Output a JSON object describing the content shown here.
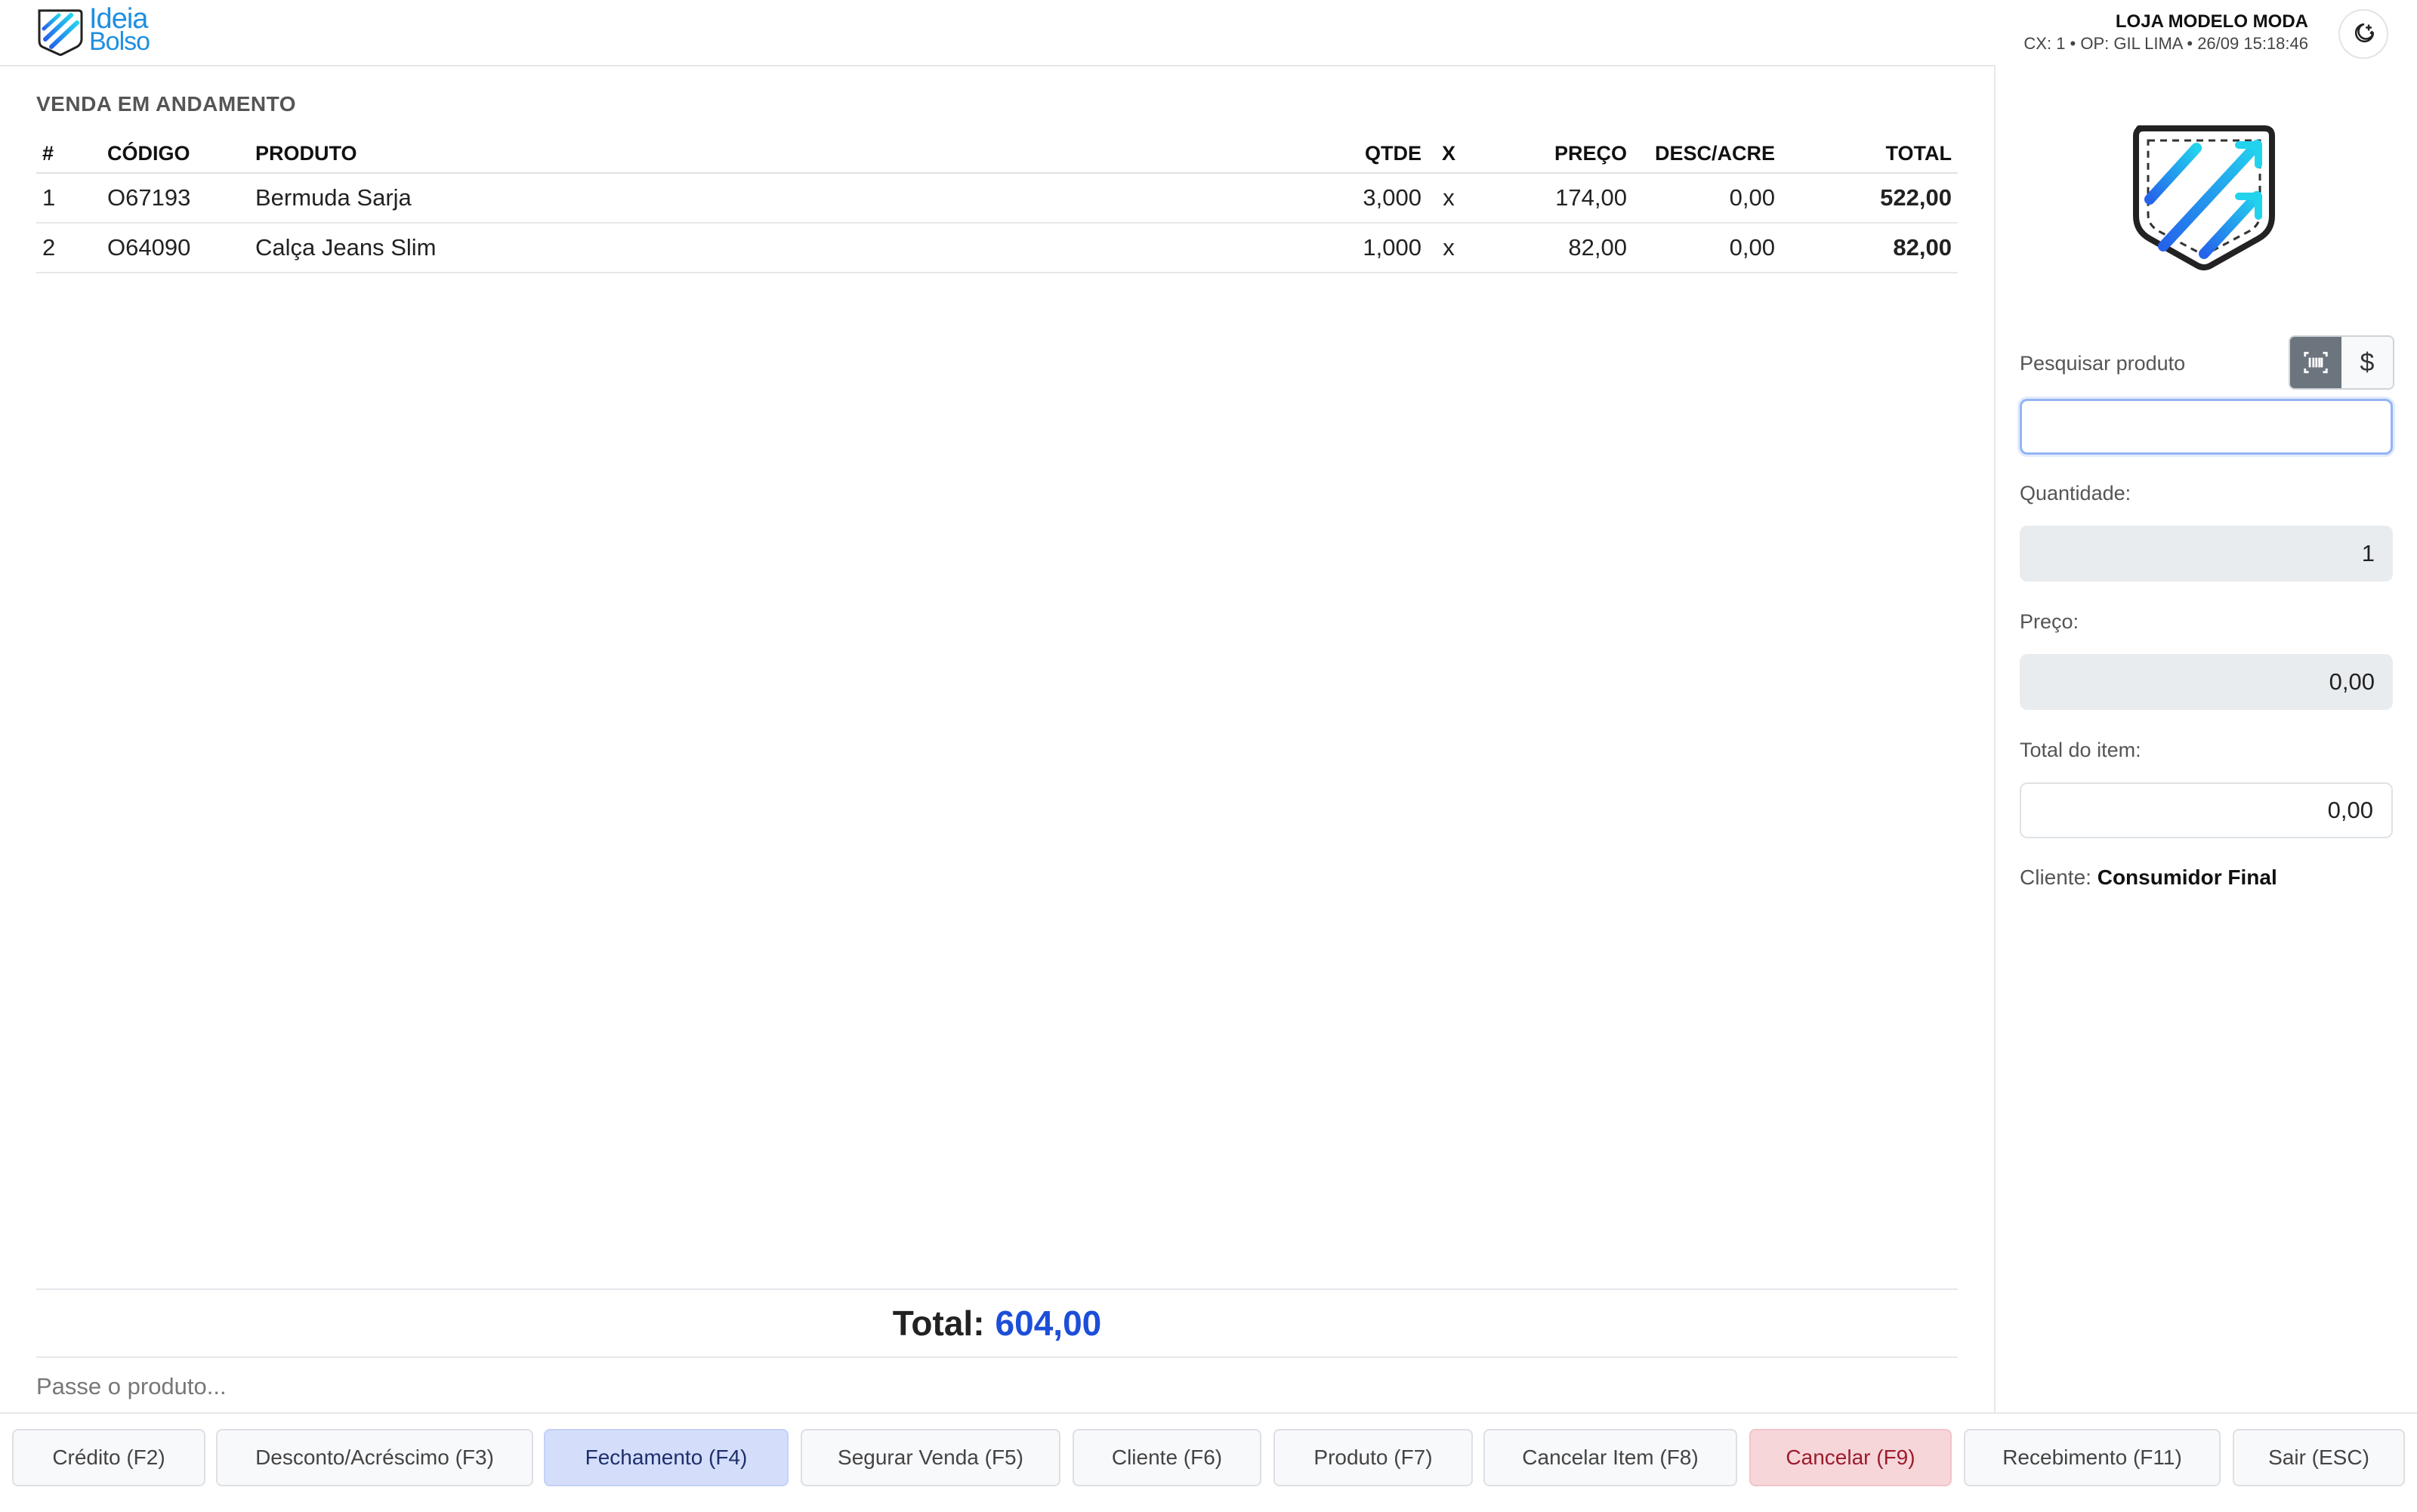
{
  "header": {
    "logo_line1": "Ideia",
    "logo_line2": "Bolso",
    "store_name": "LOJA MODELO MODA",
    "session": "CX: 1 • OP: GIL LIMA • 26/09 15:18:46",
    "theme_icon": "moon-stars-icon"
  },
  "sale": {
    "title": "VENDA EM ANDAMENTO",
    "columns": [
      "#",
      "CÓDIGO",
      "PRODUTO",
      "QTDE",
      "X",
      "PREÇO",
      "DESC/ACRE",
      "TOTAL"
    ],
    "rows": [
      {
        "n": "1",
        "code": "O67193",
        "product": "Bermuda Sarja",
        "qty": "3,000",
        "x": "x",
        "price": "174,00",
        "disc": "0,00",
        "total": "522,00"
      },
      {
        "n": "2",
        "code": "O64090",
        "product": "Calça Jeans Slim",
        "qty": "1,000",
        "x": "x",
        "price": "82,00",
        "disc": "0,00",
        "total": "82,00"
      }
    ],
    "total_label": "Total:",
    "total_value": "604,00",
    "scan_placeholder": "Passe o produto..."
  },
  "panel": {
    "search_label": "Pesquisar produto",
    "search_value": "",
    "mode_barcode_icon": "barcode-scan-icon",
    "mode_price_label": "$",
    "qty_label": "Quantidade:",
    "qty_value": "1",
    "price_label": "Preço:",
    "price_value": "0,00",
    "item_total_label": "Total do item:",
    "item_total_value": "0,00",
    "client_label": "Cliente:",
    "client_value": "Consumidor Final"
  },
  "footer": {
    "buttons": [
      "Crédito (F2)",
      "Desconto/Acréscimo (F3)",
      "Fechamento (F4)",
      "Segurar Venda (F5)",
      "Cliente (F6)",
      "Produto (F7)",
      "Cancelar Item (F8)",
      "Cancelar (F9)",
      "Recebimento (F11)",
      "Sair (ESC)"
    ]
  },
  "colors": {
    "accent": "#1d4ed8",
    "primary_button": "#d4defb",
    "danger_button": "#f7d6da",
    "logo_blue": "#1f8fe0"
  }
}
